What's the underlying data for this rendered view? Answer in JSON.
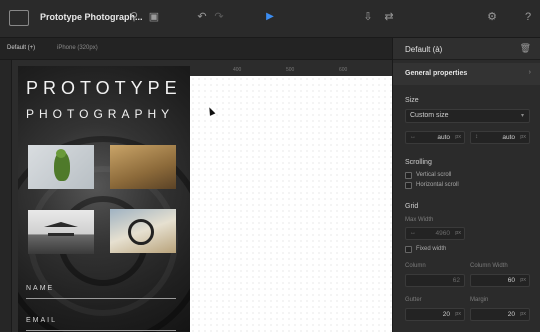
{
  "toolbar": {
    "app_logo": "",
    "doc_title": "Prototype Photograph...",
    "icons": [
      "search-icon",
      "frame-icon",
      "undo-icon",
      "redo-icon",
      "play-icon",
      "export-icon",
      "share-icon",
      "gear-icon",
      "help-icon"
    ],
    "play_color": "#3b8df2"
  },
  "device_tabs": [
    {
      "label": "Default (+)"
    },
    {
      "label": "iPhone (320px)"
    }
  ],
  "rulers": {
    "top": [
      "400",
      "500",
      "600"
    ]
  },
  "artboard": {
    "title_line_1": "PROTOTYPE",
    "title_line_2": "PHOTOGRAPHY",
    "form_labels": [
      "NAME",
      "EMAIL"
    ]
  },
  "panel": {
    "title": "Default (à)",
    "section": "General properties",
    "size": {
      "label": "Size",
      "preset": "Custom size",
      "width_prefix": "↔",
      "width_value": "auto",
      "width_unit": "px",
      "height_prefix": "↕",
      "height_value": "auto",
      "height_unit": "px"
    },
    "scrolling": {
      "label": "Scrolling",
      "vertical": "Vertical scroll",
      "horizontal": "Horizontal scroll"
    },
    "grid": {
      "label": "Grid",
      "max_width_label": "Max Width",
      "max_width_prefix": "↔",
      "max_width_value": "4960",
      "max_width_unit": "px",
      "fixed_width": "Fixed width",
      "column_label": "Column",
      "column_value": "62",
      "column_width_label": "Column Width",
      "column_width_value": "60",
      "column_width_unit": "px",
      "gutter_label": "Gutter",
      "gutter_value": "20",
      "gutter_unit": "px",
      "margin_label": "Margin",
      "margin_value": "20",
      "margin_unit": "px"
    }
  }
}
